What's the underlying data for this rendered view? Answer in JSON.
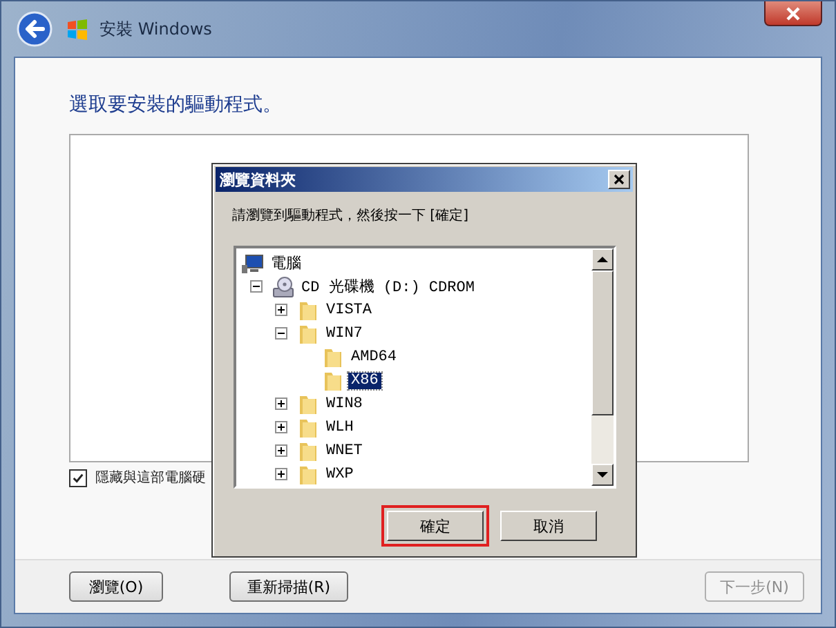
{
  "window": {
    "title": "安裝 Windows",
    "heading": "選取要安裝的驅動程式。",
    "hide_incompatible": {
      "label": "隱藏與這部電腦硬",
      "checked": true
    },
    "buttons": [
      {
        "label": "瀏覽(O)",
        "disabled": false
      },
      {
        "label": "重新掃描(R)",
        "disabled": false
      },
      {
        "label": "下一步(N)",
        "disabled": true
      }
    ]
  },
  "dialog": {
    "title": "瀏覽資料夾",
    "instruction": "請瀏覽到驅動程式，然後按一下 [確定]",
    "tree": [
      {
        "label": "電腦",
        "kind": "computer",
        "selected": false,
        "children": [
          {
            "label": "CD 光碟機 (D:) CDROM",
            "kind": "drive",
            "expanded": true,
            "selected": false,
            "children": [
              {
                "label": "VISTA",
                "kind": "folder",
                "expanded": false,
                "selected": false
              },
              {
                "label": "WIN7",
                "kind": "folder",
                "expanded": true,
                "selected": false,
                "children": [
                  {
                    "label": "AMD64",
                    "kind": "folder",
                    "selected": false
                  },
                  {
                    "label": "X86",
                    "kind": "folder",
                    "selected": true
                  }
                ]
              },
              {
                "label": "WIN8",
                "kind": "folder",
                "expanded": false,
                "selected": false
              },
              {
                "label": "WLH",
                "kind": "folder",
                "expanded": false,
                "selected": false
              },
              {
                "label": "WNET",
                "kind": "folder",
                "expanded": false,
                "selected": false
              },
              {
                "label": "WXP",
                "kind": "folder",
                "expanded": false,
                "selected": false
              }
            ]
          }
        ]
      }
    ],
    "buttons": [
      {
        "label": "確定",
        "highlighted": true
      },
      {
        "label": "取消",
        "highlighted": false
      }
    ]
  }
}
